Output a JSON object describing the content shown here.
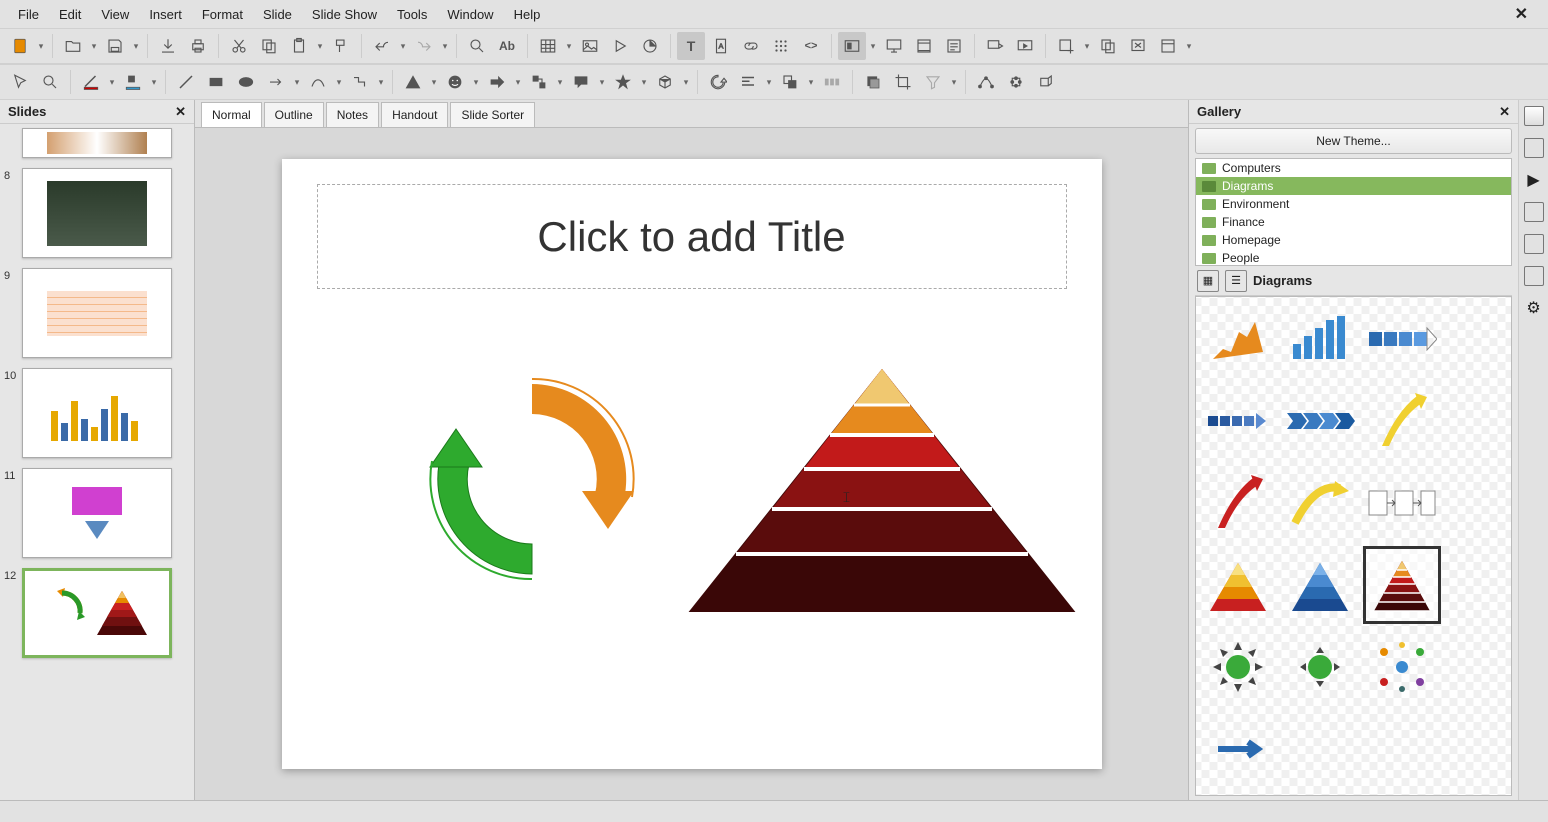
{
  "menubar": [
    "File",
    "Edit",
    "View",
    "Insert",
    "Format",
    "Slide",
    "Slide Show",
    "Tools",
    "Window",
    "Help"
  ],
  "slides_panel": {
    "title": "Slides"
  },
  "slides": [
    {
      "num": "",
      "type": "partial"
    },
    {
      "num": "8",
      "type": "photo"
    },
    {
      "num": "9",
      "type": "table"
    },
    {
      "num": "10",
      "type": "chart"
    },
    {
      "num": "11",
      "type": "shape"
    },
    {
      "num": "12",
      "type": "current"
    }
  ],
  "view_tabs": [
    "Normal",
    "Outline",
    "Notes",
    "Handout",
    "Slide Sorter"
  ],
  "active_view_tab": 0,
  "canvas": {
    "title_placeholder": "Click to add Title"
  },
  "gallery": {
    "title": "Gallery",
    "new_theme": "New Theme...",
    "themes": [
      "Computers",
      "Diagrams",
      "Environment",
      "Finance",
      "Homepage",
      "People"
    ],
    "selected_theme_index": 1,
    "current_theme_label": "Diagrams"
  }
}
